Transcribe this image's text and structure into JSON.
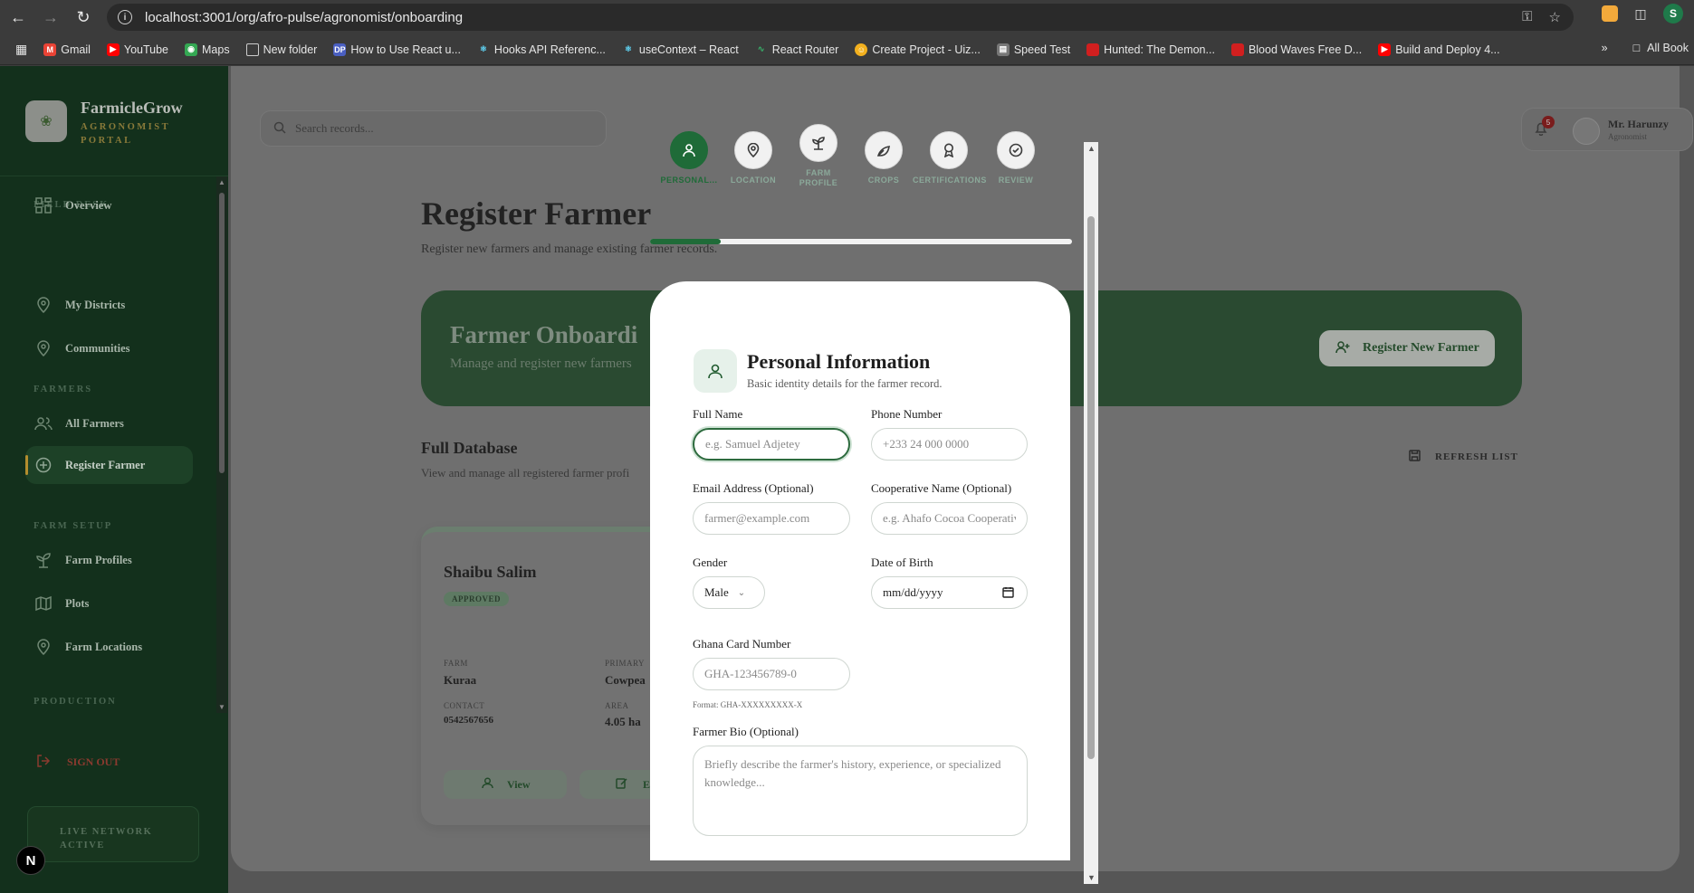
{
  "browser": {
    "url": "localhost:3001/org/afro-pulse/agronomist/onboarding",
    "bookmarks": [
      {
        "label": "Gmail",
        "icon": "gmail-icon",
        "color": "#ea4335"
      },
      {
        "label": "YouTube",
        "icon": "youtube-icon",
        "color": "#ff0000"
      },
      {
        "label": "Maps",
        "icon": "maps-icon",
        "color": "#34a853"
      },
      {
        "label": "New folder",
        "icon": "folder-icon",
        "color": "#3b3b3b"
      },
      {
        "label": "How to Use React u...",
        "icon": "dp-icon",
        "color": "#4a5fc1"
      },
      {
        "label": "Hooks API Referenc...",
        "icon": "react-icon",
        "color": "#3a8fb7"
      },
      {
        "label": "useContext – React",
        "icon": "react-icon",
        "color": "#3a8fb7"
      },
      {
        "label": "React Router",
        "icon": "router-icon",
        "color": "#1f7a4a"
      },
      {
        "label": "Create Project - Uiz...",
        "icon": "uiz-icon",
        "color": "#f2b01e"
      },
      {
        "label": "Speed Test",
        "icon": "speedtest-icon",
        "color": "#777777"
      },
      {
        "label": "Hunted: The Demon...",
        "icon": "bookmark-red-icon",
        "color": "#d11f1f"
      },
      {
        "label": "Blood Waves Free D...",
        "icon": "bookmark-red-icon",
        "color": "#d11f1f"
      },
      {
        "label": "Build and Deploy 4...",
        "icon": "youtube-icon",
        "color": "#ff0000"
      }
    ],
    "all_bookmarks": "All Book",
    "more": "»",
    "profile_initial": "S"
  },
  "sidebar": {
    "brand_name": "FarmicleGrow",
    "brand_sub": "AGRONOMIST PORTAL",
    "sections": {
      "field_desk": "FIELD DESK",
      "farmers": "FARMERS",
      "farm_setup": "FARM SETUP",
      "production": "PRODUCTION"
    },
    "items": {
      "overview": "Overview",
      "my_districts": "My Districts",
      "communities": "Communities",
      "all_farmers": "All Farmers",
      "register_farmer": "Register Farmer",
      "farm_profiles": "Farm Profiles",
      "plots": "Plots",
      "farm_locations": "Farm Locations"
    },
    "sign_out": "SIGN OUT",
    "live": "LIVE NETWORK ACTIVE",
    "next_badge": "N"
  },
  "topbar": {
    "search_placeholder": "Search records...",
    "notification_count": "5",
    "user_name": "Mr. Harunzy",
    "user_role": "Agronomist"
  },
  "page": {
    "title": "Register Farmer",
    "subtitle": "Register new farmers and manage existing farmer records.",
    "banner_title": "Farmer Onboardi",
    "banner_sub": "Manage and register new farmers",
    "register_button": "Register New Farmer",
    "db_title": "Full Database",
    "db_sub": "View and manage all registered farmer profi",
    "refresh": "REFRESH LIST"
  },
  "farmer_card": {
    "name": "Shaibu Salim",
    "status": "APPROVED",
    "farm_label": "FARM",
    "farm": "Kuraa",
    "primary_label": "PRIMARY",
    "primary": "Cowpea",
    "contact_label": "CONTACT",
    "contact": "0542567656",
    "area_label": "AREA",
    "area": "4.05 ha",
    "view": "View",
    "edit": "E"
  },
  "stepper": {
    "steps": [
      {
        "label": "PERSONAL...",
        "icon": "user-icon",
        "active": true
      },
      {
        "label": "LOCATION",
        "icon": "map-pin-icon",
        "active": false
      },
      {
        "label": "FARM PROFILE",
        "icon": "sprout-icon",
        "active": false
      },
      {
        "label": "CROPS",
        "icon": "plant-icon",
        "active": false
      },
      {
        "label": "CERTIFICATIONS",
        "icon": "award-icon",
        "active": false
      },
      {
        "label": "REVIEW",
        "icon": "check-circle-icon",
        "active": false
      }
    ],
    "progress": 0.167
  },
  "form": {
    "title": "Personal Information",
    "subtitle": "Basic identity details for the farmer record.",
    "full_name_label": "Full Name",
    "full_name_placeholder": "e.g. Samuel Adjetey",
    "phone_label": "Phone Number",
    "phone_placeholder": "+233 24 000 0000",
    "email_label": "Email Address (Optional)",
    "email_placeholder": "farmer@example.com",
    "coop_label": "Cooperative Name (Optional)",
    "coop_placeholder": "e.g. Ahafo Cocoa Cooperative",
    "gender_label": "Gender",
    "gender_value": "Male",
    "dob_label": "Date of Birth",
    "dob_value": "mm/dd/yyyy",
    "ghana_card_label": "Ghana Card Number",
    "ghana_card_placeholder": "GHA-123456789-0",
    "ghana_card_hint": "Format: GHA-XXXXXXXXX-X",
    "bio_label": "Farmer Bio (Optional)",
    "bio_placeholder": "Briefly describe the farmer's history, experience, or specialized knowledge..."
  },
  "colors": {
    "primary_green": "#1f6b38",
    "sidebar_bg": "#13301c",
    "accent_gold": "#b38d2d"
  }
}
